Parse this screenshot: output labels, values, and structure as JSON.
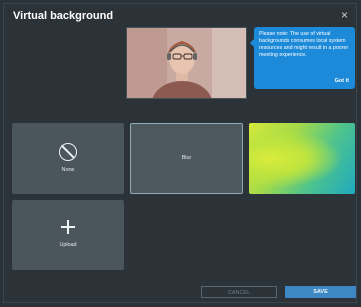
{
  "dialog": {
    "title": "Virtual background",
    "close_symbol": "×"
  },
  "tooltip": {
    "message": "Please note: The use of virtual backgrounds consumes local system resources and might result in a poorer meeting experience.",
    "action": "Got it"
  },
  "tiles": {
    "none_label": "None",
    "blur_label": "Blur",
    "upload_label": "Upload"
  },
  "buttons": {
    "cancel": "CANCEL",
    "save": "SAVE"
  },
  "icons": {
    "close": "close-icon",
    "none": "no-background-icon",
    "upload": "plus-icon"
  },
  "colors": {
    "accent": "#1c8ad8",
    "save_button": "#3d88c4",
    "background": "#2b3339",
    "tile": "#4b555c"
  }
}
